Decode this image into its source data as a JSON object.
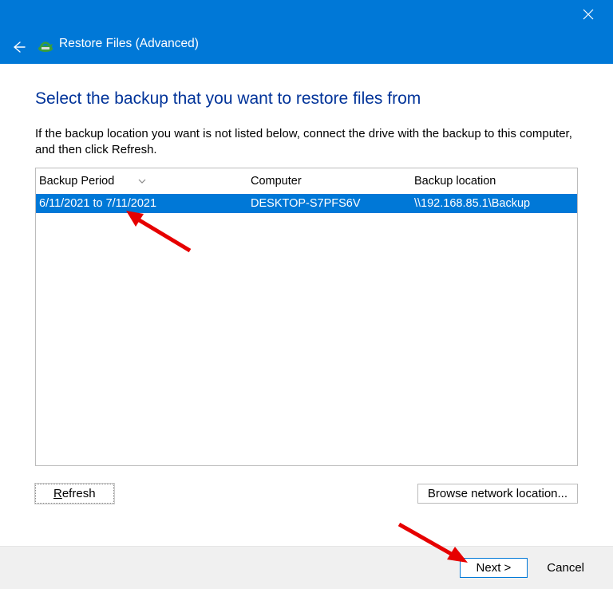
{
  "titlebar": {
    "window_title": "Restore Files (Advanced)"
  },
  "content": {
    "heading": "Select the backup that you want to restore files from",
    "instructions": "If the backup location you want is not listed below, connect the drive with the backup to this computer, and then click Refresh."
  },
  "grid": {
    "headers": {
      "period": "Backup Period",
      "computer": "Computer",
      "location": "Backup location"
    },
    "rows": [
      {
        "period": "6/11/2021 to 7/11/2021",
        "computer": "DESKTOP-S7PFS6V",
        "location": "\\\\192.168.85.1\\Backup"
      }
    ]
  },
  "buttons": {
    "refresh_prefix": "R",
    "refresh_rest": "efresh",
    "browse": "Browse network location...",
    "next": "Next >",
    "cancel": "Cancel"
  }
}
